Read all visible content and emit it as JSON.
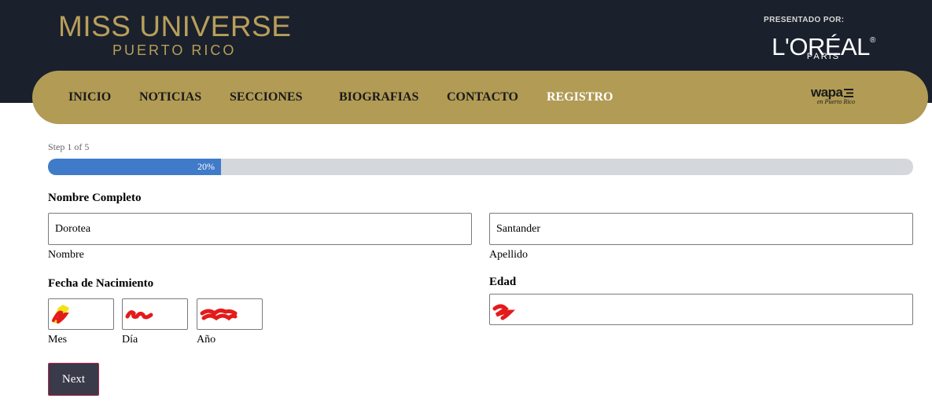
{
  "header": {
    "logo": {
      "main": "MISS UNIVERSE",
      "sub": "PUERTO RICO"
    },
    "sponsor": {
      "pre": "PRESENTADO POR:",
      "brand": "L'ORÉAL",
      "city": "PARIS"
    }
  },
  "nav": {
    "items": [
      "INICIO",
      "NOTICIAS",
      "SECCIONES",
      "BIOGRAFIAS",
      "CONTACTO",
      "REGISTRO"
    ],
    "active": "REGISTRO",
    "partner": {
      "main": "wapa",
      "sub": "en Puerto Rico"
    }
  },
  "progress": {
    "step_text": "Step 1 of 5",
    "percent": 20,
    "percent_label": "20%",
    "color": "#3f7bc8"
  },
  "form": {
    "nombre_completo": {
      "label": "Nombre Completo",
      "first": {
        "value": "Dorotea",
        "label": "Nombre"
      },
      "last": {
        "value": "Santander",
        "label": "Apellido"
      }
    },
    "fecha": {
      "label": "Fecha de Nacimiento",
      "mes": {
        "label": "Mes"
      },
      "dia": {
        "label": "Día"
      },
      "anio": {
        "label": "Año"
      }
    },
    "edad": {
      "label": "Edad"
    }
  },
  "actions": {
    "next_label": "Next"
  },
  "colors": {
    "header_bg": "#1a202c",
    "nav_bg": "#b19b55",
    "gold": "#b89f5a",
    "button_bg": "#393a4a",
    "button_border": "#b5274e",
    "redaction": "#e31b1b"
  }
}
